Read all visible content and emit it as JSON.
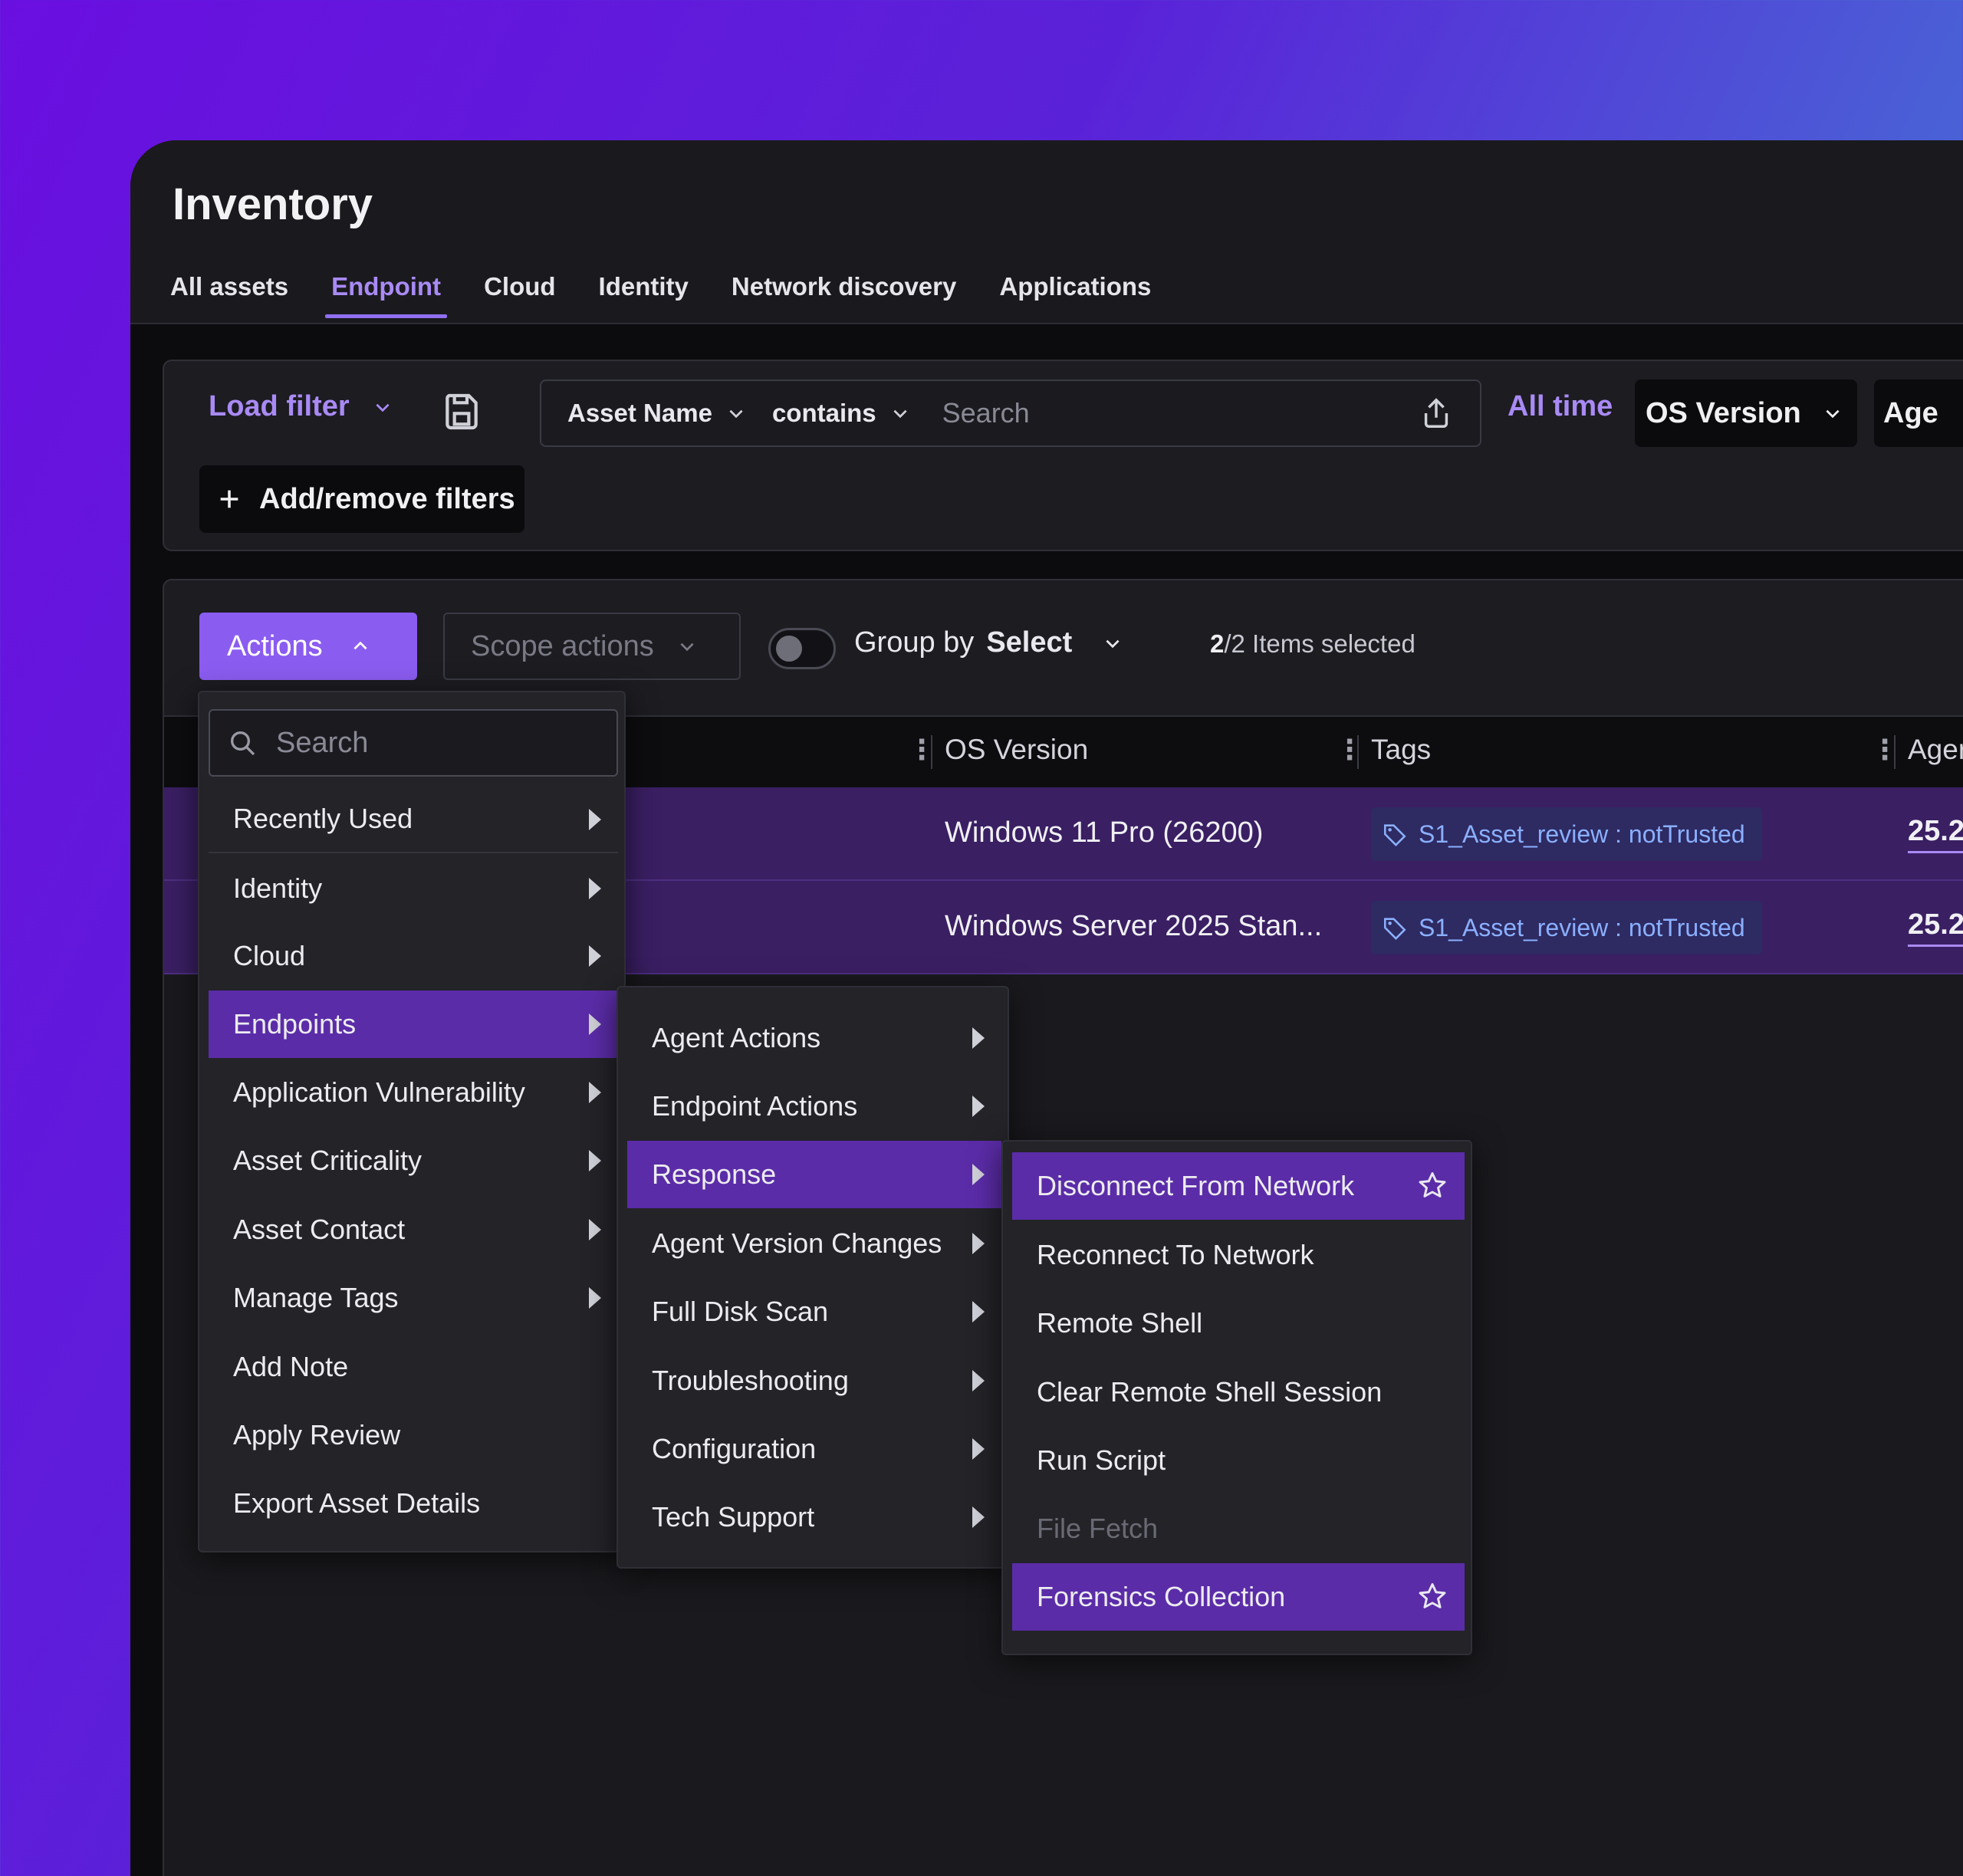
{
  "header": {
    "title": "Inventory",
    "tabs": [
      {
        "label": "All assets"
      },
      {
        "label": "Endpoint"
      },
      {
        "label": "Cloud"
      },
      {
        "label": "Identity"
      },
      {
        "label": "Network discovery"
      },
      {
        "label": "Applications"
      }
    ],
    "active_tab": "Endpoint"
  },
  "filters": {
    "load_filter_label": "Load filter",
    "field_label": "Asset Name",
    "operator_label": "contains",
    "search_placeholder": "Search",
    "time_label": "All time",
    "os_version_label": "OS Version",
    "agent_label": "Age",
    "add_remove_label": "Add/remove filters"
  },
  "toolbar": {
    "actions_label": "Actions",
    "scope_actions_label": "Scope actions",
    "group_by_label": "Group by",
    "group_by_value": "Select",
    "selected_count": "2",
    "selected_suffix": "/2 Items selected"
  },
  "table": {
    "columns": {
      "os_version": "OS Version",
      "tags": "Tags",
      "agent": "Ager"
    },
    "rows": [
      {
        "os_version": "Windows 11 Pro (26200)",
        "tag": "S1_Asset_review : notTrusted",
        "agent": "25.2"
      },
      {
        "os_version": "Windows Server 2025 Stan...",
        "tag": "S1_Asset_review : notTrusted",
        "agent": "25.2"
      }
    ]
  },
  "menus": {
    "main": {
      "search_placeholder": "Search",
      "items": [
        {
          "label": "Recently Used",
          "submenu": true
        },
        {
          "label": "Identity",
          "submenu": true
        },
        {
          "label": "Cloud",
          "submenu": true
        },
        {
          "label": "Endpoints",
          "submenu": true,
          "active": true
        },
        {
          "label": "Application Vulnerability",
          "submenu": true
        },
        {
          "label": "Asset Criticality",
          "submenu": true
        },
        {
          "label": "Asset Contact",
          "submenu": true
        },
        {
          "label": "Manage Tags",
          "submenu": true
        },
        {
          "label": "Add Note",
          "submenu": false
        },
        {
          "label": "Apply Review",
          "submenu": false
        },
        {
          "label": "Export Asset Details",
          "submenu": false
        }
      ]
    },
    "endpoints": {
      "items": [
        {
          "label": "Agent Actions"
        },
        {
          "label": "Endpoint Actions"
        },
        {
          "label": "Response",
          "active": true
        },
        {
          "label": "Agent Version Changes"
        },
        {
          "label": "Full Disk Scan"
        },
        {
          "label": "Troubleshooting"
        },
        {
          "label": "Configuration"
        },
        {
          "label": "Tech Support"
        }
      ]
    },
    "response": {
      "items": [
        {
          "label": "Disconnect From Network",
          "highlighted": true,
          "favorite": true
        },
        {
          "label": "Reconnect To Network"
        },
        {
          "label": "Remote Shell"
        },
        {
          "label": "Clear Remote Shell Session"
        },
        {
          "label": "Run Script"
        },
        {
          "label": "File Fetch",
          "disabled": true
        },
        {
          "label": "Forensics Collection",
          "highlighted": true,
          "favorite": true
        }
      ]
    }
  },
  "colors": {
    "accent": "#8b5cf0",
    "accent_text": "#a98af5",
    "menu_active": "#5b2ca8",
    "row_selected": "#3a1f63",
    "tag_text": "#8ab0ff"
  }
}
